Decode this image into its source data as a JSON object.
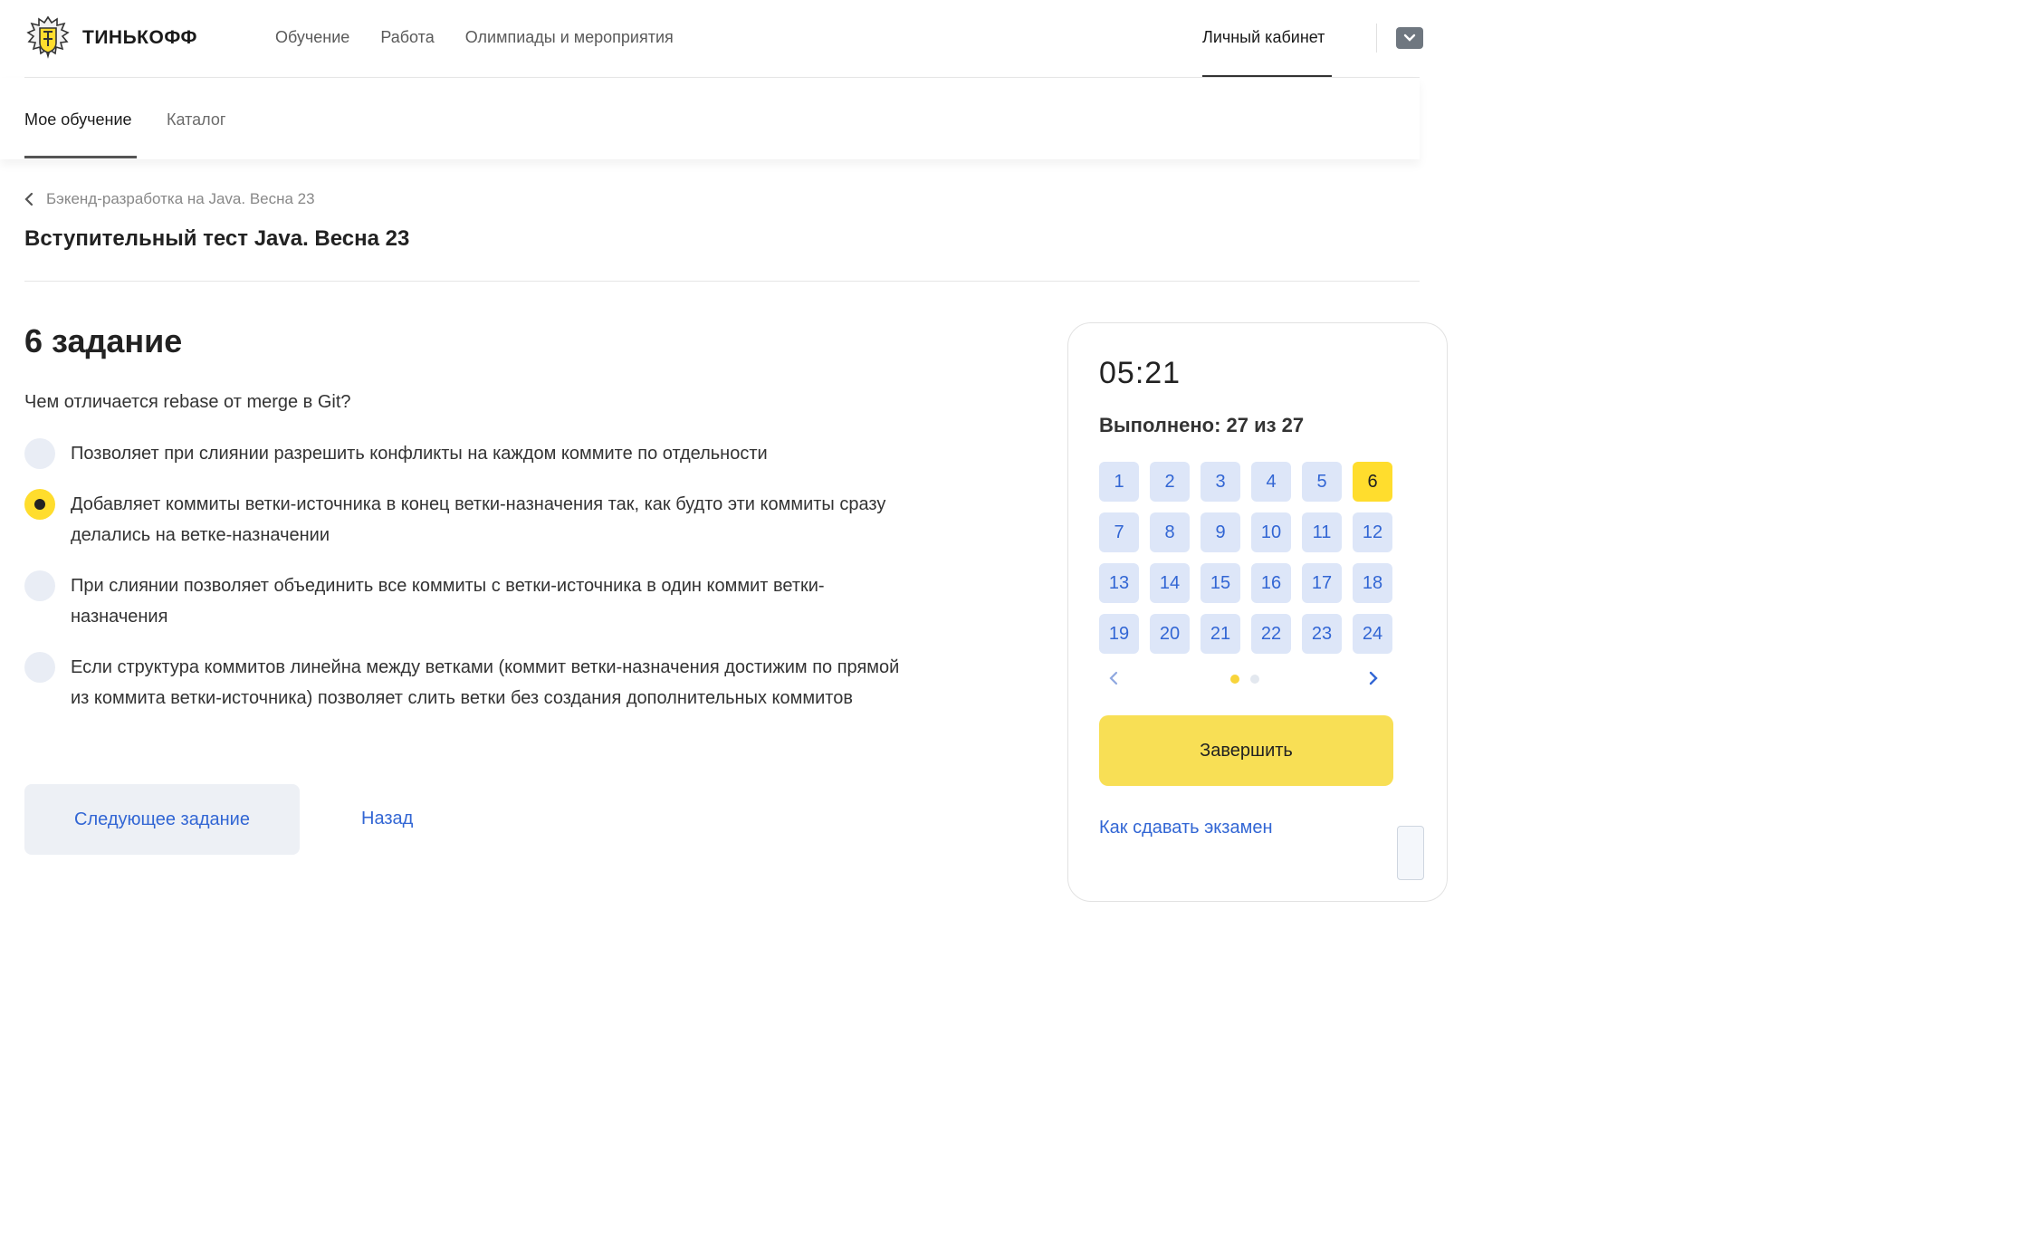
{
  "header": {
    "brand": "ТИНЬКОФФ",
    "nav": [
      "Обучение",
      "Работа",
      "Олимпиады и мероприятия"
    ],
    "cabinet": "Личный кабинет"
  },
  "subnav": {
    "my_learning": "Мое обучение",
    "catalog": "Каталог"
  },
  "breadcrumb": "Бэкенд-разработка на Java. Весна 23",
  "page_title": "Вступительный тест Java. Весна 23",
  "task": {
    "title": "6 задание",
    "question": "Чем отличается rebase от merge в Git?",
    "options": [
      {
        "text": "Позволяет при слиянии разрешить конфликты на каждом коммите по отдельности",
        "selected": false
      },
      {
        "text": "Добавляет коммиты ветки-источника в конец ветки-назначения так, как будто эти коммиты сразу делались на ветке-назначении",
        "selected": true
      },
      {
        "text": "При слиянии позволяет объединить все коммиты с ветки-источника в один коммит ветки-назначения",
        "selected": false
      },
      {
        "text": "Если структура коммитов линейна между ветками (коммит ветки-назначения достижим по прямой из коммита ветки-источника) позволяет слить ветки без создания дополнительных коммитов",
        "selected": false
      }
    ],
    "next_label": "Следующее задание",
    "back_label": "Назад"
  },
  "panel": {
    "timer": "05:21",
    "done": "Выполнено: 27 из 27",
    "active": 6,
    "numbers": [
      "1",
      "2",
      "3",
      "4",
      "5",
      "6",
      "7",
      "8",
      "9",
      "10",
      "11",
      "12",
      "13",
      "14",
      "15",
      "16",
      "17",
      "18",
      "19",
      "20",
      "21",
      "22",
      "23",
      "24"
    ],
    "page_dots": 2,
    "current_page": 1,
    "finish_label": "Завершить",
    "how_label": "Как сдавать экзамен"
  },
  "colors": {
    "accent_yellow": "#ffdd2d",
    "link_blue": "#3266d4",
    "cell_bg": "#dde6f8"
  }
}
